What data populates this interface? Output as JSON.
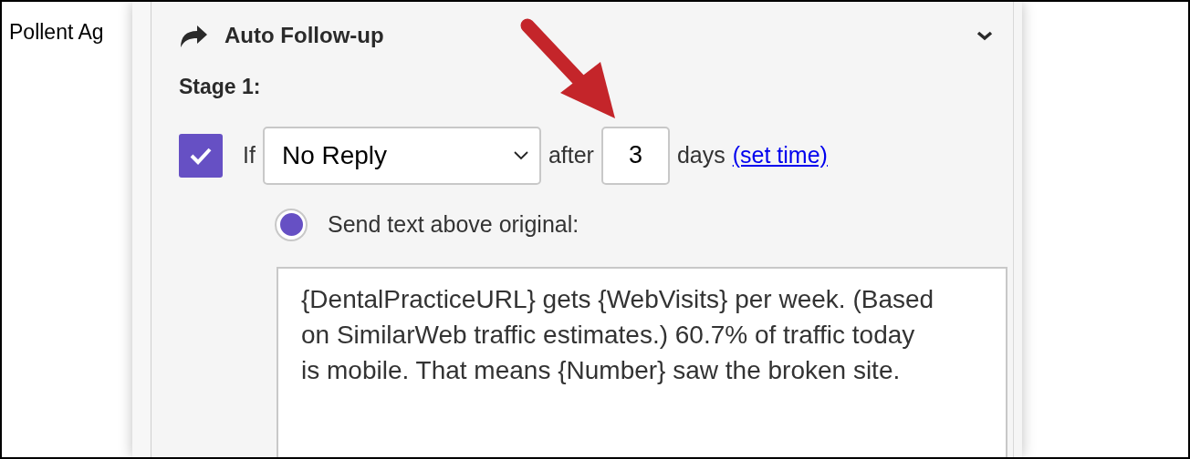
{
  "background_text": "Pollent Ag",
  "section": {
    "title": "Auto Follow-up",
    "expanded": true
  },
  "stage": {
    "label": "Stage 1:",
    "enabled": true,
    "condition_prefix": "If",
    "condition": "No Reply",
    "after_label": "after",
    "days": "3",
    "days_label": "days",
    "link": "(set time)"
  },
  "options": [
    {
      "label": "Send text above original:",
      "selected": true
    }
  ],
  "message": "{DentalPracticeURL} gets {WebVisits} per week. (Based on SimilarWeb traffic estimates.) 60.7% of traffic today is mobile. That means {Number} saw the broken site."
}
